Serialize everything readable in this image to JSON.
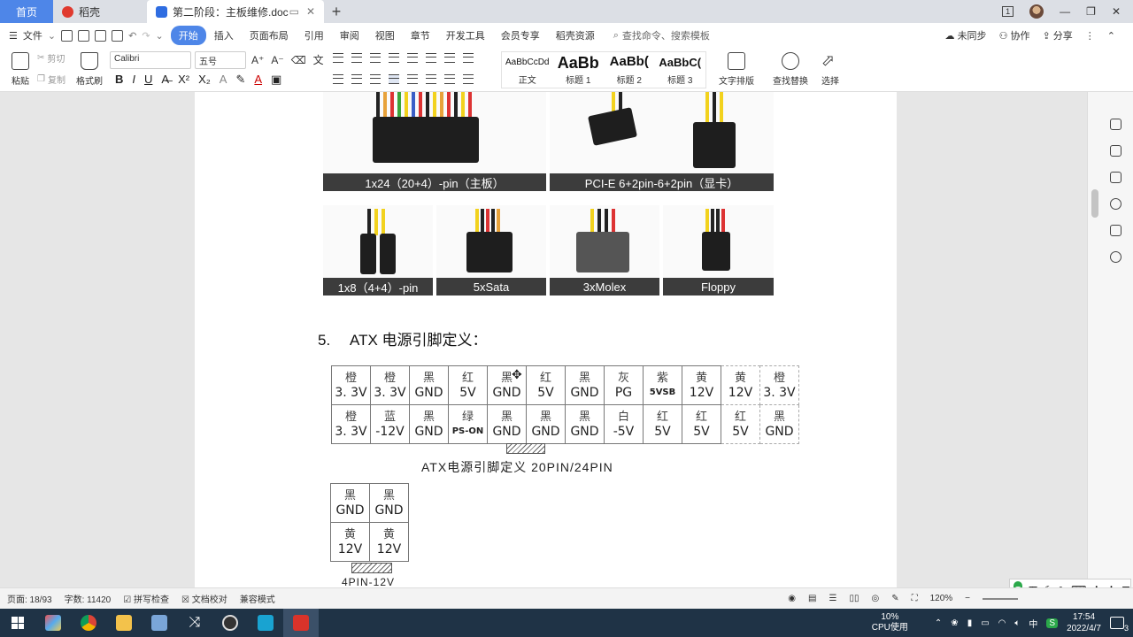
{
  "tabs": {
    "home": "首页",
    "daoke": "稻壳",
    "doc": "第二阶段：主板维修.doc",
    "add": "+"
  },
  "menu": {
    "file": "文件",
    "items": [
      "开始",
      "插入",
      "页面布局",
      "引用",
      "审阅",
      "视图",
      "章节",
      "开发工具",
      "会员专享",
      "稻壳资源"
    ],
    "search": "查找命令、搜索模板",
    "sync": "未同步",
    "collab": "协作",
    "share": "分享"
  },
  "ribbon": {
    "paste": "粘贴",
    "cut": "剪切",
    "copy": "复制",
    "format_painter": "格式刷",
    "font_name": "Calibri",
    "font_size": "五号",
    "styles": [
      {
        "sample": "AaBbCcDd",
        "label": "正文"
      },
      {
        "sample": "AaBb",
        "label": "标题 1"
      },
      {
        "sample": "AaBb(",
        "label": "标题 2"
      },
      {
        "sample": "AaBbC(",
        "label": "标题 3"
      }
    ],
    "text_layout": "文字排版",
    "find_replace": "查找替换",
    "select": "选择"
  },
  "doc": {
    "captions_row1": [
      "1x24（20+4）-pin（主板）",
      "PCI-E 6+2pin-6+2pin（显卡）"
    ],
    "captions_row2": [
      "1x8（4+4）-pin",
      "5xSata",
      "3xMolex",
      "Floppy"
    ],
    "heading_num": "5.",
    "heading_text": "ATX 电源引脚定义：",
    "pin_rows": [
      [
        {
          "c": "橙",
          "s": "3. 3V"
        },
        {
          "c": "橙",
          "s": "3. 3V"
        },
        {
          "c": "黑",
          "s": "GND"
        },
        {
          "c": "红",
          "s": "5V"
        },
        {
          "c": "黑",
          "s": "GND"
        },
        {
          "c": "红",
          "s": "5V"
        },
        {
          "c": "黑",
          "s": "GND"
        },
        {
          "c": "灰",
          "s": "PG"
        },
        {
          "c": "紫",
          "s": "5VSB"
        },
        {
          "c": "黄",
          "s": "12V"
        },
        {
          "c": "黄",
          "s": "12V"
        },
        {
          "c": "橙",
          "s": "3. 3V"
        }
      ],
      [
        {
          "c": "橙",
          "s": "3. 3V"
        },
        {
          "c": "蓝",
          "s": "-12V"
        },
        {
          "c": "黑",
          "s": "GND"
        },
        {
          "c": "绿",
          "s": "PS-ON"
        },
        {
          "c": "黑",
          "s": "GND"
        },
        {
          "c": "黑",
          "s": "GND"
        },
        {
          "c": "黑",
          "s": "GND"
        },
        {
          "c": "白",
          "s": "-5V"
        },
        {
          "c": "红",
          "s": "5V"
        },
        {
          "c": "红",
          "s": "5V"
        },
        {
          "c": "红",
          "s": "5V"
        },
        {
          "c": "黑",
          "s": "GND"
        }
      ]
    ],
    "pin_caption": "ATX电源引脚定义 20PIN/24PIN",
    "pin4_rows": [
      [
        {
          "c": "黑",
          "s": "GND"
        },
        {
          "c": "黑",
          "s": "GND"
        }
      ],
      [
        {
          "c": "黄",
          "s": "12V"
        },
        {
          "c": "黄",
          "s": "12V"
        }
      ]
    ],
    "pin4_caption": "4PIN-12V"
  },
  "status": {
    "page": "页面: 18/93",
    "words": "字数: 11420",
    "spell": "拼写检查",
    "proof": "文档校对",
    "compat": "兼容模式",
    "zoom": "120%"
  },
  "taskbar": {
    "cpu_pct": "10%",
    "cpu_label": "CPU使用",
    "ime": "中",
    "time": "17:54",
    "date": "2022/4/7",
    "notif_count": "3"
  },
  "ime_bar": {
    "mode": "五"
  },
  "colors": {
    "accent": "#4e86e8",
    "taskbar": "#1f3346",
    "caption_bg": "#3c3c3c"
  }
}
